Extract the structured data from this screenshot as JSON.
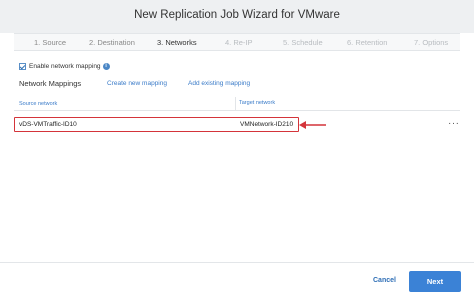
{
  "window": {
    "title": "New Replication Job Wizard for VMware"
  },
  "steps": [
    {
      "label": "1. Source",
      "state": "done"
    },
    {
      "label": "2. Destination",
      "state": "done"
    },
    {
      "label": "3. Networks",
      "state": "current"
    },
    {
      "label": "4. Re-IP",
      "state": "disabled"
    },
    {
      "label": "5. Schedule",
      "state": "disabled"
    },
    {
      "label": "6. Retention",
      "state": "disabled"
    },
    {
      "label": "7. Options",
      "state": "disabled"
    }
  ],
  "enable_mapping": {
    "label": "Enable network mapping",
    "checked": true,
    "info_icon": "info-icon"
  },
  "network_mappings": {
    "title": "Network Mappings",
    "create_link": "Create new mapping",
    "add_link": "Add existing mapping"
  },
  "table": {
    "columns": [
      "Source network",
      "Target network"
    ],
    "rows": [
      {
        "source": "vDS-VMTraffic-ID10",
        "target": "VMNetwork-ID210",
        "menu": "···"
      }
    ]
  },
  "annotation": {
    "highlight_color": "#d4343a",
    "arrow_icon": "left-arrow-icon"
  },
  "footer": {
    "cancel_label": "Cancel",
    "next_label": "Next"
  },
  "colors": {
    "accent": "#3b82d6",
    "link": "#3a7bc8"
  }
}
